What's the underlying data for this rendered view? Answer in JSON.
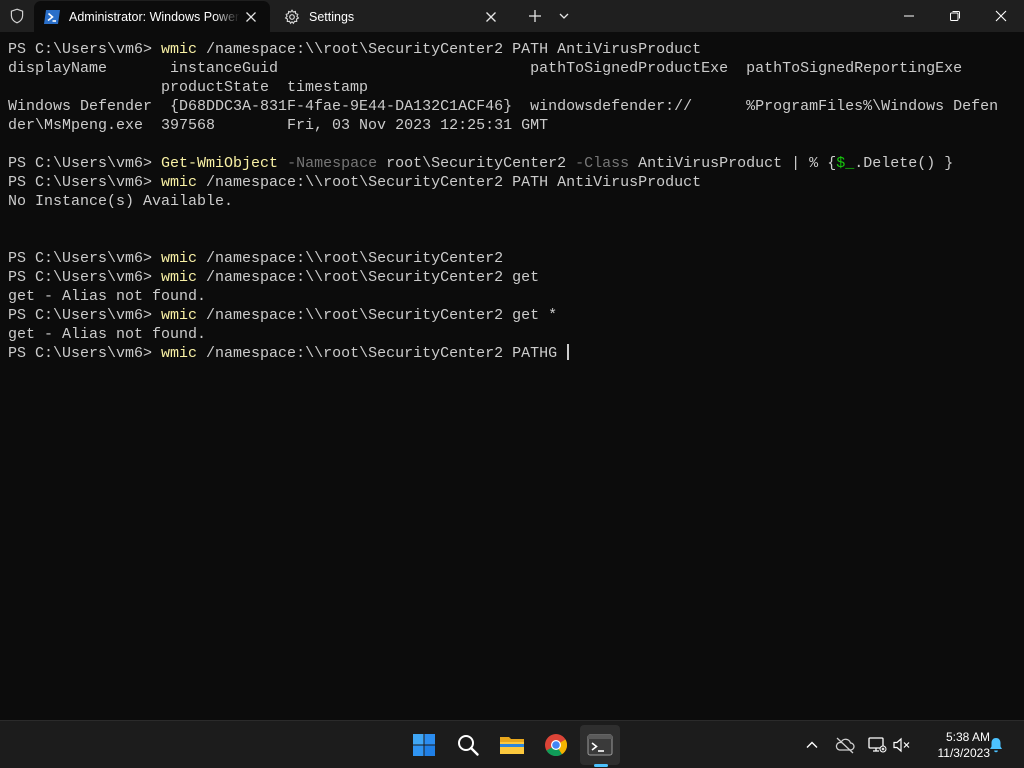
{
  "titlebar": {
    "tabs": [
      {
        "title": "Administrator: Windows PowerShell",
        "active": true,
        "icon": "powershell-icon"
      },
      {
        "title": "Settings",
        "active": false,
        "icon": "gear-icon"
      }
    ],
    "close_glyph": "✕",
    "new_tab_glyph": "+",
    "window_controls": {
      "minimize": "minimize-icon",
      "maximize": "restore-icon",
      "close": "close-icon"
    }
  },
  "colors": {
    "terminal_bg": "#0c0c0c",
    "text": "#cccccc",
    "command": "#f9f1a5",
    "parameter": "#767676",
    "variable": "#16c60c",
    "accent": "#4cc2ff"
  },
  "terminal": {
    "lines": [
      [
        {
          "t": "PS C:\\Users\\vm6> "
        },
        {
          "t": "wmic",
          "c": "y"
        },
        {
          "t": " /namespace:\\\\root\\SecurityCenter2 PATH AntiVirusProduct"
        }
      ],
      [
        {
          "t": "displayName       instanceGuid                            pathToSignedProductExe  pathToSignedReportingExe"
        }
      ],
      [
        {
          "t": "                 productState  timestamp"
        }
      ],
      [
        {
          "t": "Windows Defender  {D68DDC3A-831F-4fae-9E44-DA132C1ACF46}  windowsdefender://      %ProgramFiles%\\Windows Defen"
        }
      ],
      [
        {
          "t": "der\\MsMpeng.exe  397568        Fri, 03 Nov 2023 12:25:31 GMT"
        }
      ],
      [],
      [
        {
          "t": "PS C:\\Users\\vm6> "
        },
        {
          "t": "Get-WmiObject",
          "c": "y"
        },
        {
          "t": " "
        },
        {
          "t": "-Namespace",
          "c": "g"
        },
        {
          "t": " root\\SecurityCenter2 "
        },
        {
          "t": "-Class",
          "c": "g"
        },
        {
          "t": " AntiVirusProduct | % {"
        },
        {
          "t": "$_",
          "c": "gr"
        },
        {
          "t": ".Delete() }"
        }
      ],
      [
        {
          "t": "PS C:\\Users\\vm6> "
        },
        {
          "t": "wmic",
          "c": "y"
        },
        {
          "t": " /namespace:\\\\root\\SecurityCenter2 PATH AntiVirusProduct"
        }
      ],
      [
        {
          "t": "No Instance(s) Available."
        }
      ],
      [],
      [],
      [
        {
          "t": "PS C:\\Users\\vm6> "
        },
        {
          "t": "wmic",
          "c": "y"
        },
        {
          "t": " /namespace:\\\\root\\SecurityCenter2"
        }
      ],
      [
        {
          "t": "PS C:\\Users\\vm6> "
        },
        {
          "t": "wmic",
          "c": "y"
        },
        {
          "t": " /namespace:\\\\root\\SecurityCenter2 get"
        }
      ],
      [
        {
          "t": "get - Alias not found."
        }
      ],
      [
        {
          "t": "PS C:\\Users\\vm6> "
        },
        {
          "t": "wmic",
          "c": "y"
        },
        {
          "t": " /namespace:\\\\root\\SecurityCenter2 get *"
        }
      ],
      [
        {
          "t": "get - Alias not found."
        }
      ],
      [
        {
          "t": "PS C:\\Users\\vm6> "
        },
        {
          "t": "wmic",
          "c": "y"
        },
        {
          "t": " /namespace:\\\\root\\SecurityCenter2 PATHG "
        }
      ]
    ],
    "cursor_line": 16
  },
  "taskbar": {
    "apps": [
      {
        "name": "start",
        "icon": "windows-start-icon"
      },
      {
        "name": "search",
        "icon": "search-icon"
      },
      {
        "name": "file-explorer",
        "icon": "folder-icon"
      },
      {
        "name": "chrome",
        "icon": "chrome-icon"
      },
      {
        "name": "terminal",
        "icon": "terminal-icon",
        "active": true
      }
    ],
    "tray": {
      "icons": [
        "chevron-up-icon",
        "cloud-off-icon",
        "network-icon",
        "volume-muted-icon",
        "notification-bell-icon"
      ],
      "time": "5:38 AM",
      "date": "11/3/2023"
    }
  }
}
